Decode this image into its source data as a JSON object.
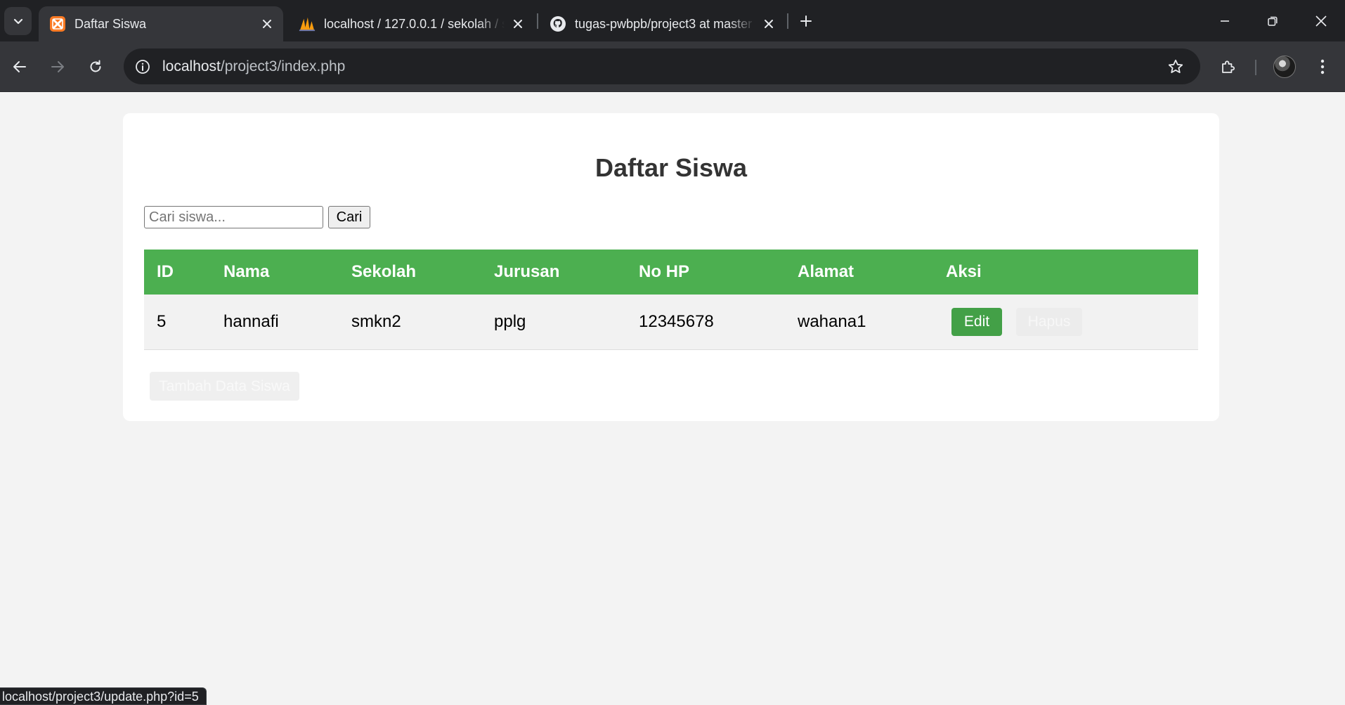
{
  "browser": {
    "tabs": [
      {
        "title": "Daftar Siswa",
        "icon": "xampp-icon",
        "active": true
      },
      {
        "title": "localhost / 127.0.0.1 / sekolah / s",
        "icon": "phpmyadmin-icon",
        "active": false
      },
      {
        "title": "tugas-pwbpb/project3 at master",
        "icon": "github-icon",
        "active": false
      }
    ],
    "address": {
      "host": "localhost",
      "path": "/project3/index.php"
    },
    "status_url": "localhost/project3/update.php?id=5"
  },
  "page": {
    "title": "Daftar Siswa",
    "search": {
      "placeholder": "Cari siswa...",
      "value": "",
      "button_label": "Cari"
    },
    "table": {
      "headers": [
        "ID",
        "Nama",
        "Sekolah",
        "Jurusan",
        "No HP",
        "Alamat",
        "Aksi"
      ],
      "rows": [
        {
          "id": "5",
          "nama": "hannafi",
          "sekolah": "smkn2",
          "jurusan": "pplg",
          "no_hp": "12345678",
          "alamat": "wahana1",
          "edit_label": "Edit",
          "hapus_label": "Hapus"
        }
      ]
    },
    "add_button_label": "Tambah Data Siswa"
  },
  "colors": {
    "header_green": "#4caf50",
    "edit_green": "#43a047",
    "chrome_dark": "#202124",
    "chrome_toolbar": "#35363a"
  }
}
